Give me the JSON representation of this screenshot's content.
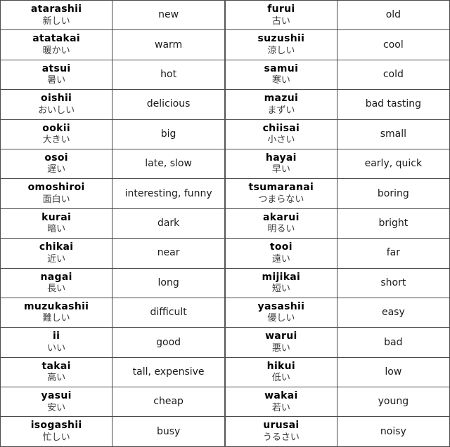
{
  "table": {
    "description": "Japanese i-adjective vocabulary table of opposite pairs",
    "column_count": 4,
    "row_count": 15,
    "border_color": "#4a4a4a",
    "romaji_color": "#000000",
    "kana_color": "#3a3a3a",
    "meaning_color": "#1a1a1a",
    "background_color": "#ffffff",
    "rows": [
      {
        "left": {
          "romaji": "atarashii",
          "kana": "新しい",
          "meaning": "new"
        },
        "right": {
          "romaji": "furui",
          "kana": "古い",
          "meaning": "old"
        }
      },
      {
        "left": {
          "romaji": "atatakai",
          "kana": "暖かい",
          "meaning": "warm"
        },
        "right": {
          "romaji": "suzushii",
          "kana": "涼しい",
          "meaning": "cool"
        }
      },
      {
        "left": {
          "romaji": "atsui",
          "kana": "暑い",
          "meaning": "hot"
        },
        "right": {
          "romaji": "samui",
          "kana": "寒い",
          "meaning": "cold"
        }
      },
      {
        "left": {
          "romaji": "oishii",
          "kana": "おいしい",
          "meaning": "delicious"
        },
        "right": {
          "romaji": "mazui",
          "kana": "まずい",
          "meaning": "bad tasting"
        }
      },
      {
        "left": {
          "romaji": "ookii",
          "kana": "大きい",
          "meaning": "big"
        },
        "right": {
          "romaji": "chiisai",
          "kana": "小さい",
          "meaning": "small"
        }
      },
      {
        "left": {
          "romaji": "osoi",
          "kana": "遅い",
          "meaning": "late, slow"
        },
        "right": {
          "romaji": "hayai",
          "kana": "早い",
          "meaning": "early, quick"
        }
      },
      {
        "left": {
          "romaji": "omoshiroi",
          "kana": "面白い",
          "meaning": "interesting, funny"
        },
        "right": {
          "romaji": "tsumaranai",
          "kana": "つまらない",
          "meaning": "boring"
        }
      },
      {
        "left": {
          "romaji": "kurai",
          "kana": "暗い",
          "meaning": "dark"
        },
        "right": {
          "romaji": "akarui",
          "kana": "明るい",
          "meaning": "bright"
        }
      },
      {
        "left": {
          "romaji": "chikai",
          "kana": "近い",
          "meaning": "near"
        },
        "right": {
          "romaji": "tooi",
          "kana": "遠い",
          "meaning": "far"
        }
      },
      {
        "left": {
          "romaji": "nagai",
          "kana": "長い",
          "meaning": "long"
        },
        "right": {
          "romaji": "mijikai",
          "kana": "短い",
          "meaning": "short"
        }
      },
      {
        "left": {
          "romaji": "muzukashii",
          "kana": "難しい",
          "meaning": "difficult"
        },
        "right": {
          "romaji": "yasashii",
          "kana": "優しい",
          "meaning": "easy"
        }
      },
      {
        "left": {
          "romaji": "ii",
          "kana": "いい",
          "meaning": "good"
        },
        "right": {
          "romaji": "warui",
          "kana": "悪い",
          "meaning": "bad"
        }
      },
      {
        "left": {
          "romaji": "takai",
          "kana": "高い",
          "meaning": "tall, expensive"
        },
        "right": {
          "romaji": "hikui",
          "kana": "低い",
          "meaning": "low"
        }
      },
      {
        "left": {
          "romaji": "yasui",
          "kana": "安い",
          "meaning": "cheap"
        },
        "right": {
          "romaji": "wakai",
          "kana": "若い",
          "meaning": "young"
        }
      },
      {
        "left": {
          "romaji": "isogashii",
          "kana": "忙しい",
          "meaning": "busy"
        },
        "right": {
          "romaji": "urusai",
          "kana": "うるさい",
          "meaning": "noisy"
        }
      }
    ]
  }
}
